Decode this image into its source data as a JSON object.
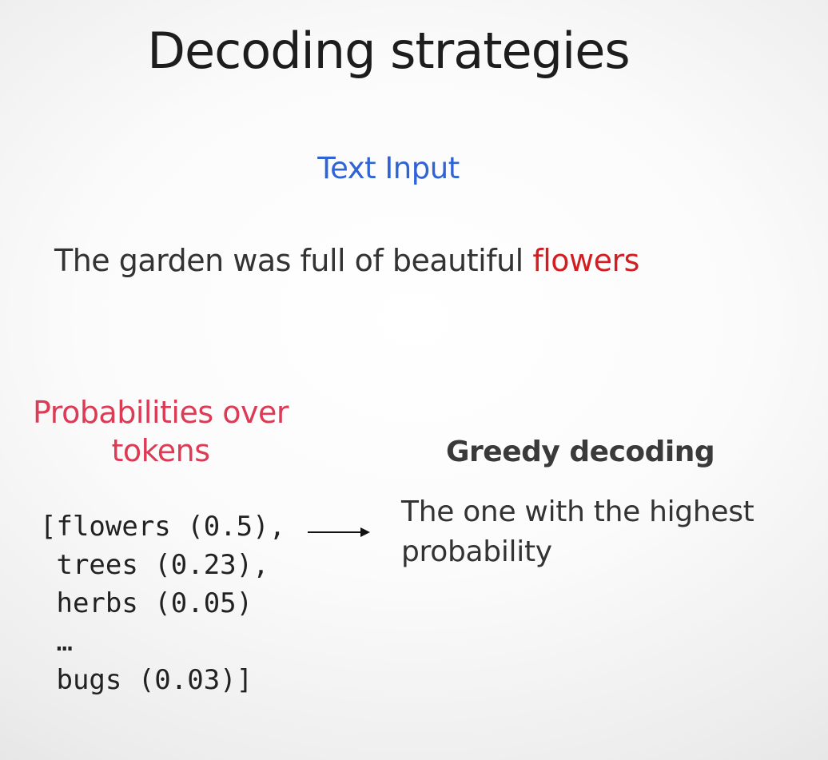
{
  "slide": {
    "title": "Decoding strategies",
    "text_input_label": "Text Input",
    "sentence": {
      "prefix": "The garden was full of beautiful ",
      "highlight": "flowers"
    },
    "probabilities_heading": [
      "Probabilities over",
      "tokens"
    ],
    "token_lines": [
      "[flowers (0.5),",
      " trees (0.23),",
      " herbs (0.05)",
      " …",
      " bugs (0.03)]"
    ],
    "greedy": {
      "heading": "Greedy decoding",
      "description": [
        "The one with the highest",
        "probability"
      ]
    }
  },
  "colors": {
    "title": "#1d1d1d",
    "text_input_label": "#2f63d6",
    "highlight": "#d21d21",
    "probabilities_heading": "#db3b55",
    "body_text": "#333333"
  },
  "icons": {
    "arrow": "right-arrow-icon"
  }
}
